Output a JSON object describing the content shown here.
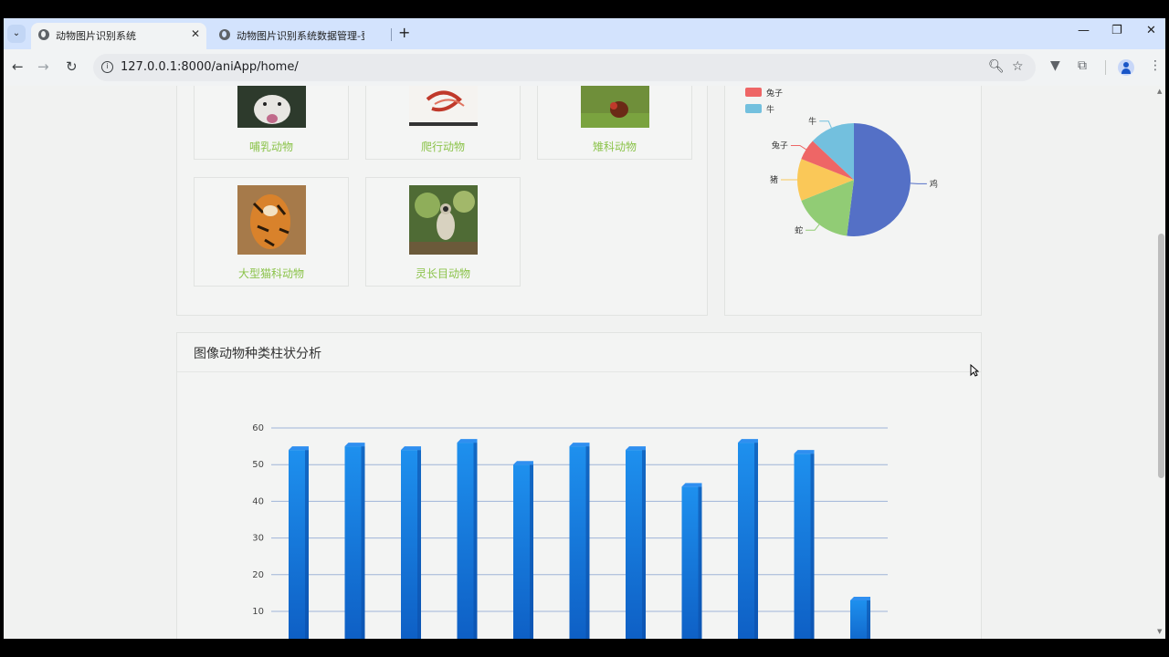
{
  "browser": {
    "tabs": [
      {
        "title": "动物图片识别系统",
        "active": true
      },
      {
        "title": "动物图片识别系统数据管理-登录",
        "active": false
      }
    ],
    "url": "127.0.0.1:8000/aniApp/home/"
  },
  "categories": [
    {
      "label": "哺乳动物",
      "image": "dog-photo"
    },
    {
      "label": "爬行动物",
      "image": "snake-photo"
    },
    {
      "label": "雉科动物",
      "image": "rooster-photo"
    },
    {
      "label": "大型猫科动物",
      "image": "tiger-photo"
    },
    {
      "label": "灵长目动物",
      "image": "monkey-photo"
    }
  ],
  "pie_chart": {
    "legend": [
      {
        "label": "兔子",
        "color": "#ee6666"
      },
      {
        "label": "牛",
        "color": "#73c0de"
      }
    ]
  },
  "bar_section": {
    "title": "图像动物种类柱状分析"
  },
  "chart_data": [
    {
      "type": "pie",
      "labels": [
        "鸡",
        "蛇",
        "猪",
        "兔子",
        "牛"
      ],
      "values": [
        52,
        17,
        12,
        6,
        13
      ],
      "colors": [
        "#5470c6",
        "#91cc75",
        "#fac858",
        "#ee6666",
        "#73c0de"
      ],
      "legend": [
        "兔子",
        "牛"
      ]
    },
    {
      "type": "bar",
      "title": "图像动物种类柱状分析",
      "values": [
        54,
        55,
        54,
        56,
        50,
        55,
        54,
        44,
        56,
        53,
        13
      ],
      "yticks": [
        10,
        20,
        30,
        40,
        50,
        60
      ],
      "ylim": [
        0,
        60
      ],
      "grid": true,
      "color": "#1e88e5"
    }
  ]
}
